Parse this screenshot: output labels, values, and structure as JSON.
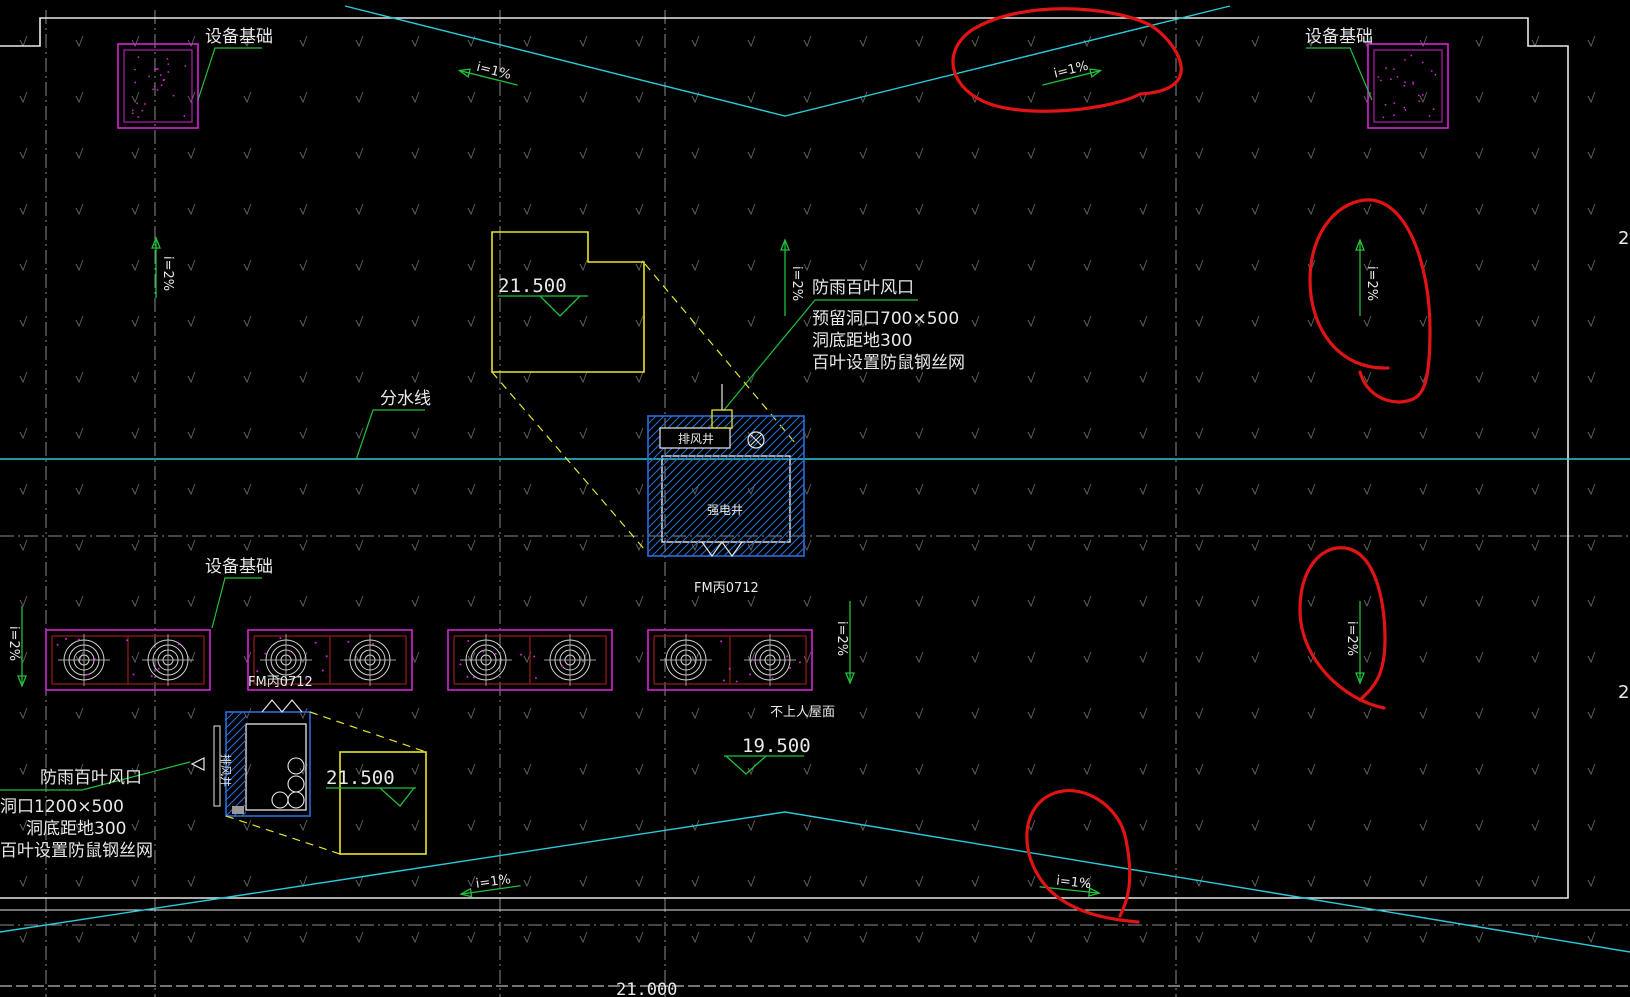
{
  "colors": {
    "background": "#000000",
    "cyan": "#2cc8d8",
    "white": "#e8e8e8",
    "grid": "#7c7c7c",
    "yellow": "#e8e62a",
    "green": "#22c03a",
    "magenta": "#d423d4",
    "blue": "#2b6fd8",
    "red_markup": "#e01414",
    "dark_red": "#9a1a1a"
  },
  "labels": {
    "equipment_base": "设备基础",
    "rain_louver": "防雨百叶风口",
    "reserved_opening_700": "预留洞口700×500",
    "sill_height_300": "洞底距地300",
    "louver_mesh": "百叶设置防鼠钢丝网",
    "opening_1200": "洞口1200×500",
    "watershed_line": "分水线",
    "exhaust_shaft": "排风井",
    "electrical_shaft": "强电井",
    "door_code": "FM丙0712",
    "non_accessible_roof": "不上人屋面",
    "slope_1pct": "i=1%",
    "slope_2pct": "i=2%",
    "elev_21500": "21.500",
    "elev_19500": "19.500",
    "dim_21000": "21.000",
    "edge_char_2": "2"
  },
  "icons": {
    "slope_arrow": "slope-arrow-icon",
    "elevation_marker": "elevation-triangle-icon",
    "fan": "exhaust-fan-icon",
    "pipe": "pipe-riser-icon"
  }
}
